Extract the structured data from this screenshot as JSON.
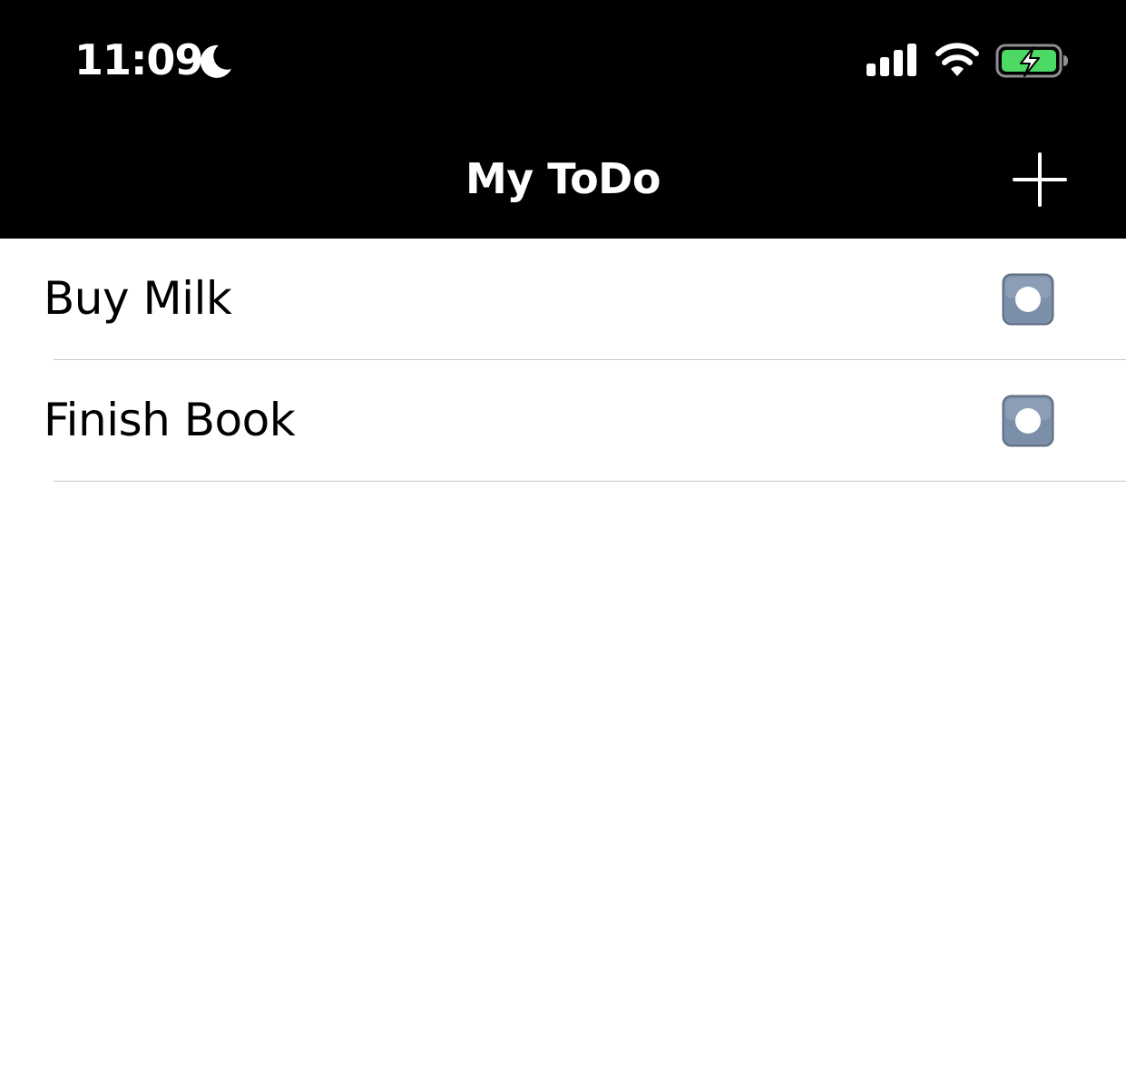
{
  "status_bar": {
    "time": "11:09",
    "icons": [
      "moon-icon",
      "cellular-signal-icon",
      "wifi-icon",
      "battery-charging-icon"
    ]
  },
  "nav": {
    "title": "My ToDo",
    "add_icon": "plus-icon"
  },
  "todos": [
    {
      "label": "Buy Milk",
      "checkbox_icon": "record-button-icon"
    },
    {
      "label": "Finish Book",
      "checkbox_icon": "record-button-icon"
    }
  ],
  "colors": {
    "bar_background": "#000000",
    "bar_text": "#ffffff",
    "battery_fill": "#4cd964",
    "checkbox_fill": "#7b8fa8",
    "separator": "#c8c8cc"
  }
}
